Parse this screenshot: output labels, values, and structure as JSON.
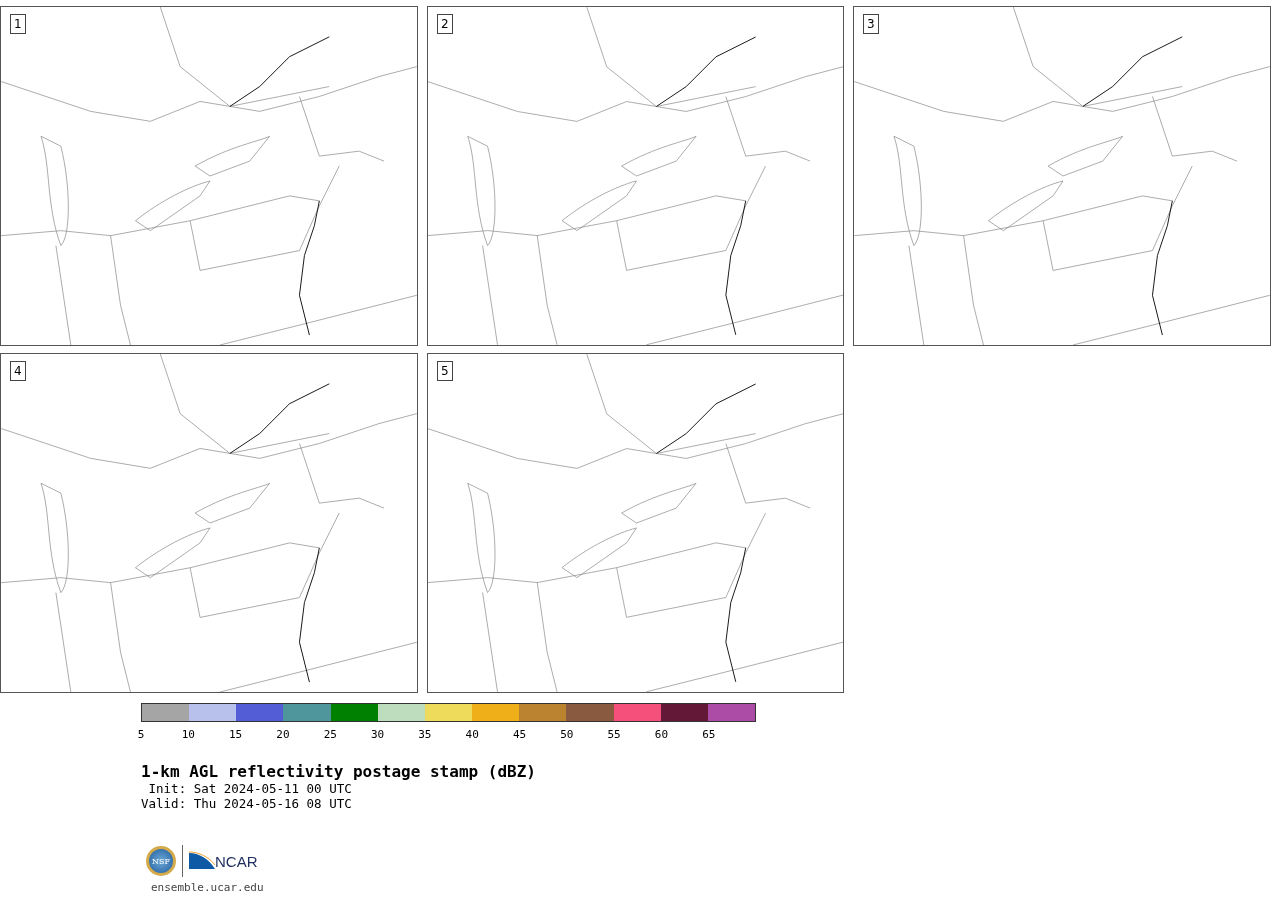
{
  "panels": [
    {
      "label": "1"
    },
    {
      "label": "2"
    },
    {
      "label": "3"
    },
    {
      "label": "4"
    },
    {
      "label": "5"
    }
  ],
  "colorbar": [
    {
      "label": "5",
      "color": "#a5a5a5"
    },
    {
      "label": "10",
      "color": "#b7c1ec"
    },
    {
      "label": "15",
      "color": "#525dd6"
    },
    {
      "label": "20",
      "color": "#4f969c"
    },
    {
      "label": "25",
      "color": "#008000"
    },
    {
      "label": "30",
      "color": "#bedcbe"
    },
    {
      "label": "35",
      "color": "#eedb5c"
    },
    {
      "label": "40",
      "color": "#efaf18"
    },
    {
      "label": "45",
      "color": "#bb8230"
    },
    {
      "label": "50",
      "color": "#8a5a40"
    },
    {
      "label": "55",
      "color": "#f5507c"
    },
    {
      "label": "60",
      "color": "#631837"
    },
    {
      "label": "65",
      "color": "#ad4ca6"
    }
  ],
  "title": "1-km AGL reflectivity postage stamp (dBZ)",
  "init": " Init: Sat 2024-05-11 00 UTC",
  "valid": "Valid: Thu 2024-05-16 08 UTC",
  "logo": {
    "left": "NSF",
    "right": "NCAR"
  },
  "site": "ensemble.ucar.edu"
}
